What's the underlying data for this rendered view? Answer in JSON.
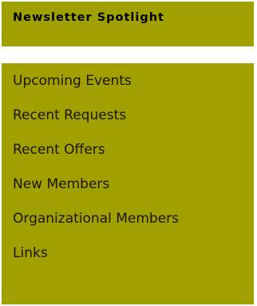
{
  "spotlight": {
    "title": "Newsletter Spotlight"
  },
  "nav": {
    "items": [
      {
        "label": "Upcoming Events"
      },
      {
        "label": "Recent Requests"
      },
      {
        "label": "Recent Offers"
      },
      {
        "label": "New Members"
      },
      {
        "label": "Organizational Members"
      },
      {
        "label": "Links"
      }
    ]
  },
  "colors": {
    "panel_background": "#a0a000",
    "title_text": "#000000",
    "link_text": "#1c1400",
    "page_background": "#ffffff"
  }
}
